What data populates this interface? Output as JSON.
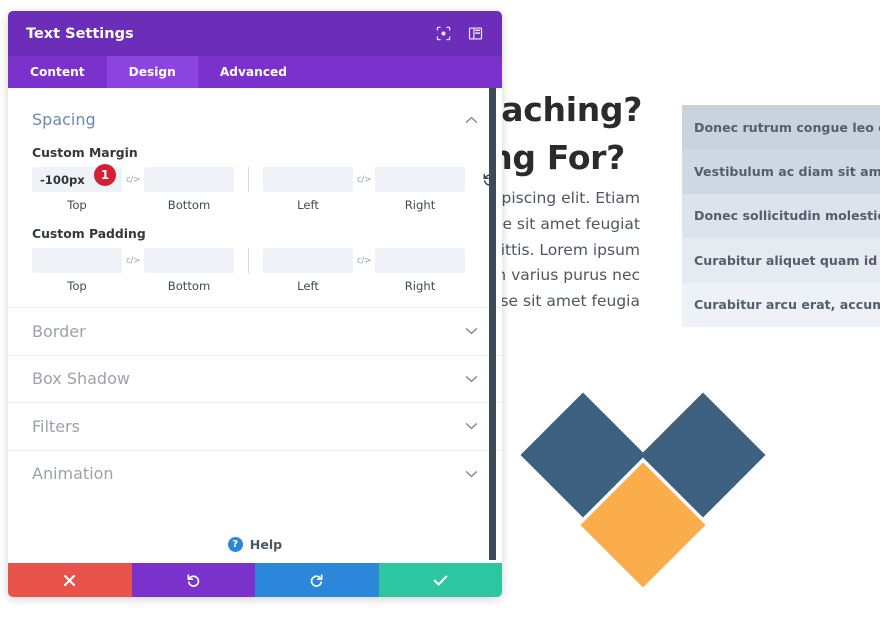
{
  "modal": {
    "title": "Text Settings",
    "header_icons": [
      {
        "name": "focus-icon"
      },
      {
        "name": "layout-panel-icon"
      }
    ],
    "tabs": [
      {
        "label": "Content",
        "active": false
      },
      {
        "label": "Design",
        "active": true
      },
      {
        "label": "Advanced",
        "active": false
      }
    ],
    "spacing": {
      "title": "Spacing",
      "collapse_chevron": "⌃",
      "custom_margin": {
        "label": "Custom Margin",
        "badge": "1",
        "fields": [
          {
            "sub": "Top",
            "value": "-100px"
          },
          {
            "sub": "Bottom",
            "value": ""
          },
          {
            "sub": "Left",
            "value": ""
          },
          {
            "sub": "Right",
            "value": ""
          }
        ]
      },
      "custom_padding": {
        "label": "Custom Padding",
        "fields": [
          {
            "sub": "Top",
            "value": ""
          },
          {
            "sub": "Bottom",
            "value": ""
          },
          {
            "sub": "Left",
            "value": ""
          },
          {
            "sub": "Right",
            "value": ""
          }
        ]
      }
    },
    "collapsed_sections": [
      {
        "label": "Border",
        "chevron": "⌄"
      },
      {
        "label": "Box Shadow",
        "chevron": "⌄"
      },
      {
        "label": "Filters",
        "chevron": "⌄"
      },
      {
        "label": "Animation",
        "chevron": "⌄"
      }
    ],
    "help": {
      "label": "Help",
      "icon_glyph": "?"
    },
    "footer_buttons": [
      {
        "name": "close-button",
        "icon": "close-x-icon",
        "color": "#e8534c"
      },
      {
        "name": "undo-button",
        "icon": "undo-arrow-icon",
        "color": "#7b32cc"
      },
      {
        "name": "redo-button",
        "icon": "redo-arrow-icon",
        "color": "#2b87da"
      },
      {
        "name": "save-button",
        "icon": "checkmark-icon",
        "color": "#2cc6a0"
      }
    ],
    "colors": {
      "header": "#6c2eb9",
      "tabbar": "#7b32cc",
      "tab_active": "#8c44e0",
      "group_title": "#6a8bad",
      "badge": "#d42034"
    }
  },
  "page": {
    "headline_lines": [
      "Coaching?",
      "hing For?"
    ],
    "paragraph_lines": [
      "r adipiscing elit. Etiam",
      "ndisse sit amet feugiat",
      "sagittis. Lorem ipsum",
      "Etiam varius purus nec",
      "ndisse sit amet feugia"
    ],
    "blurb_list": [
      "Donec rutrum congue leo eget mal",
      "Vestibulum ac diam sit amet quam",
      "Donec sollicitudin molestie malesu",
      "Curabitur aliquet quam id dui posu",
      "Curabitur arcu erat, accumsan id i"
    ],
    "logo": {
      "name": "diamond-heart-logo",
      "blue_color": "#3d6080",
      "orange_color": "#fbad4c"
    }
  }
}
